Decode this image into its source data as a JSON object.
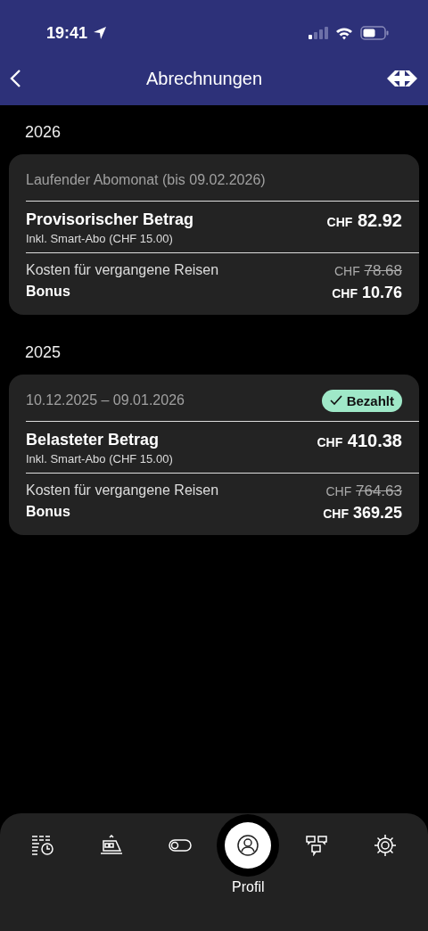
{
  "status_bar": {
    "time": "19:41"
  },
  "header": {
    "title": "Abrechnungen"
  },
  "sections": [
    {
      "year": "2026",
      "card": {
        "period": "Laufender Abomonat (bis 09.02.2026)",
        "main_label": "Provisorischer Betrag",
        "main_sub": "Inkl. Smart-Abo (CHF 15.00)",
        "main_amount": {
          "currency": "CHF",
          "value": "82.92"
        },
        "costs_label": "Kosten für vergangene Reisen",
        "costs_amount": {
          "currency": "CHF",
          "value": "78.68"
        },
        "bonus_label": "Bonus",
        "bonus_amount": {
          "currency": "CHF",
          "value": "10.76"
        }
      }
    },
    {
      "year": "2025",
      "card": {
        "period": "10.12.2025 – 09.01.2026",
        "status": "Bezahlt",
        "main_label": "Belasteter Betrag",
        "main_sub": "Inkl. Smart-Abo (CHF 15.00)",
        "main_amount": {
          "currency": "CHF",
          "value": "410.38"
        },
        "costs_label": "Kosten für vergangene Reisen",
        "costs_amount": {
          "currency": "CHF",
          "value": "764.63"
        },
        "bonus_label": "Bonus",
        "bonus_amount": {
          "currency": "CHF",
          "value": "369.25"
        }
      }
    }
  ],
  "tabs": [
    {
      "kind": "timetable",
      "selected": false
    },
    {
      "kind": "train",
      "selected": false
    },
    {
      "kind": "toggle",
      "selected": false
    },
    {
      "kind": "profile",
      "selected": true,
      "label": "Profil"
    },
    {
      "kind": "chat",
      "selected": false
    },
    {
      "kind": "settings",
      "selected": false
    }
  ]
}
